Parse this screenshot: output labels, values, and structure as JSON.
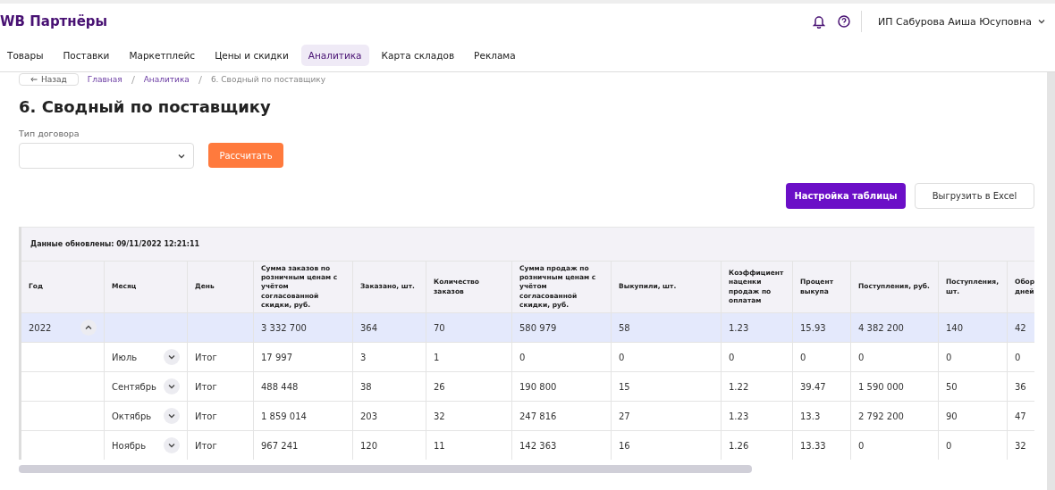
{
  "header": {
    "logo": "WB Партнёры",
    "user": "ИП Сабурова Аиша Юсуповна"
  },
  "nav": [
    {
      "label": "Товары",
      "selected": false
    },
    {
      "label": "Поставки",
      "selected": false
    },
    {
      "label": "Маркетплейс",
      "selected": false
    },
    {
      "label": "Цены и скидки",
      "selected": false
    },
    {
      "label": "Аналитика",
      "selected": true
    },
    {
      "label": "Карта складов",
      "selected": false
    },
    {
      "label": "Реклама",
      "selected": false
    }
  ],
  "breadcrumb": {
    "back": "Назад",
    "items": [
      "Главная",
      "Аналитика",
      "6. Сводный по поставщику"
    ]
  },
  "title": "6. Сводный по поставщику",
  "filter": {
    "label": "Тип договора",
    "button": "Рассчитать"
  },
  "actions": {
    "settings": "Настройка таблицы",
    "export": "Выгрузить в Excel"
  },
  "table": {
    "updated": "Данные обновлены: 09/11/2022 12:21:11",
    "columns": [
      "Год",
      "Месяц",
      "День",
      "Сумма заказов по розничным ценам с учётом согласованной скидки, руб.",
      "Заказано, шт.",
      "Количество заказов",
      "Сумма продаж по розничным ценам с учётом согласованной скидки, руб.",
      "Выкупили, шт.",
      "Коэффициент наценки продаж по оплатам",
      "Процент выкупа",
      "Поступления, руб.",
      "Поступления, шт.",
      "Обор дней"
    ],
    "rows": [
      {
        "kind": "year",
        "expanded": true,
        "cells": [
          "2022",
          "",
          "",
          "3 332 700",
          "364",
          "70",
          "580 979",
          "58",
          "1.23",
          "15.93",
          "4 382 200",
          "140",
          "42"
        ]
      },
      {
        "kind": "month",
        "expanded": false,
        "cells": [
          "",
          "Июль",
          "Итог",
          "17 997",
          "3",
          "1",
          "0",
          "0",
          "0",
          "0",
          "0",
          "0",
          "0"
        ]
      },
      {
        "kind": "month",
        "expanded": false,
        "cells": [
          "",
          "Сентябрь",
          "Итог",
          "488 448",
          "38",
          "26",
          "190 800",
          "15",
          "1.22",
          "39.47",
          "1 590 000",
          "50",
          "36"
        ]
      },
      {
        "kind": "month",
        "expanded": false,
        "cells": [
          "",
          "Октябрь",
          "Итог",
          "1 859 014",
          "203",
          "32",
          "247 816",
          "27",
          "1.23",
          "13.3",
          "2 792 200",
          "90",
          "47"
        ]
      },
      {
        "kind": "month",
        "expanded": false,
        "cells": [
          "",
          "Ноябрь",
          "Итог",
          "967 241",
          "120",
          "11",
          "142 363",
          "16",
          "1.26",
          "13.33",
          "0",
          "0",
          "32"
        ]
      }
    ]
  }
}
